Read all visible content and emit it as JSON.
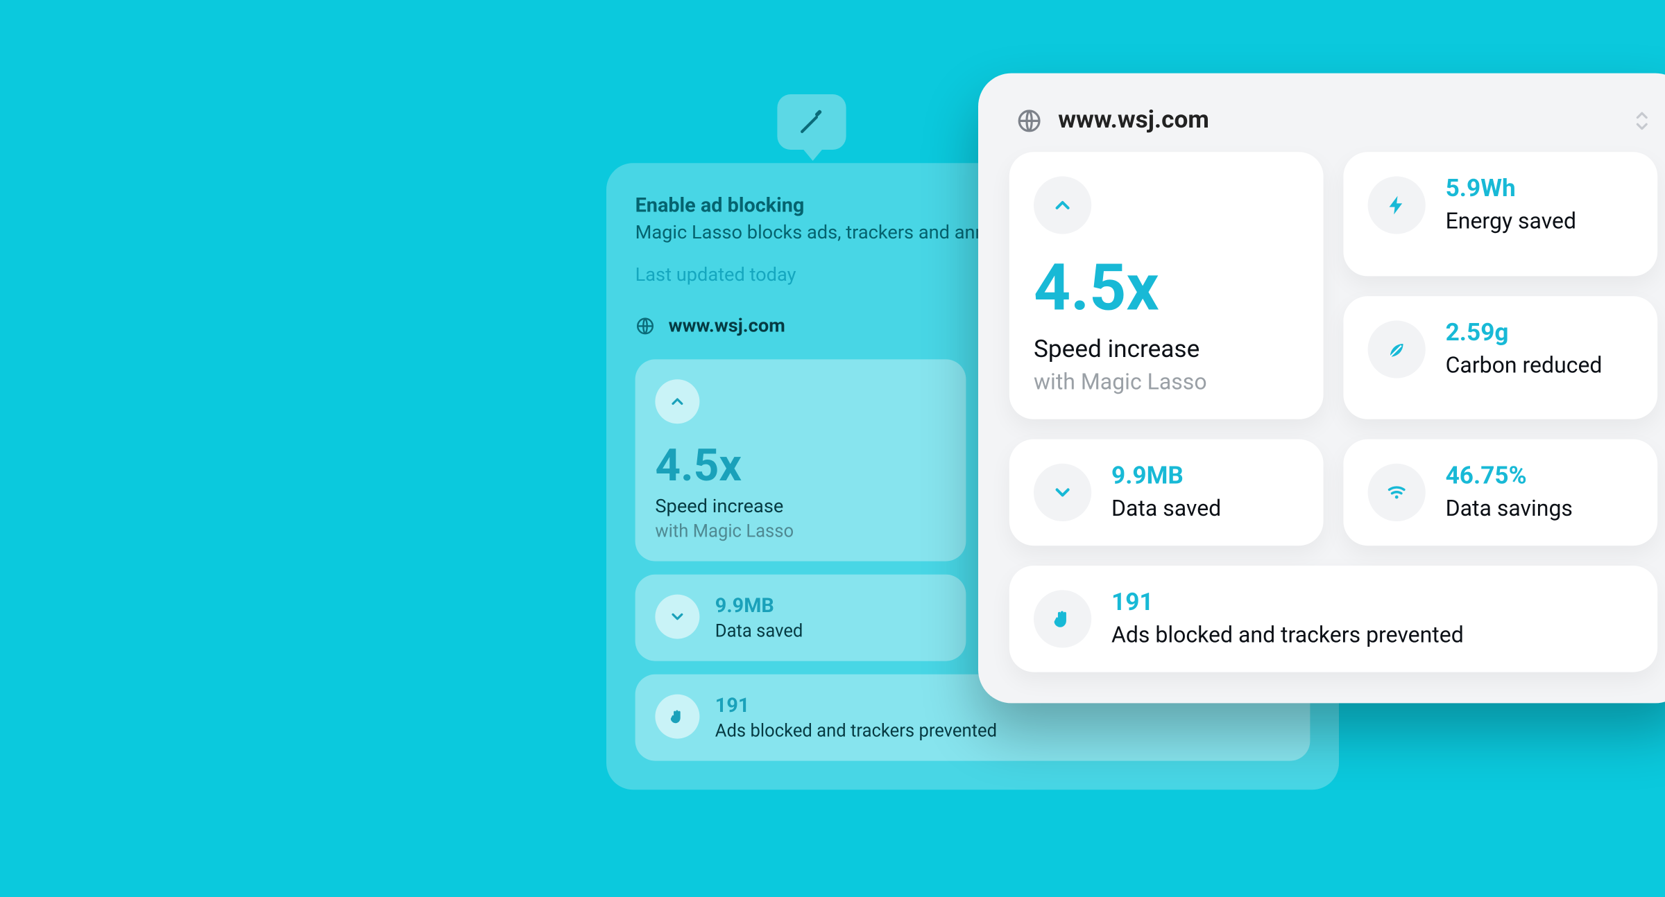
{
  "toolbar": {
    "icon_name": "wand-icon"
  },
  "popover": {
    "title": "Enable ad blocking",
    "subtitle": "Magic Lasso blocks ads, trackers and annoyances",
    "updated": "Last updated today",
    "site": "www.wsj.com"
  },
  "panel": {
    "site": "www.wsj.com"
  },
  "stats": {
    "speed": {
      "value": "4.5x",
      "label": "Speed increase",
      "sublabel": "with Magic Lasso",
      "icon": "chevron-up-icon"
    },
    "energy": {
      "value": "5.9Wh",
      "label": "Energy saved",
      "icon": "bolt-icon"
    },
    "carbon": {
      "value": "2.59g",
      "label": "Carbon reduced",
      "icon": "leaf-icon"
    },
    "data_saved": {
      "value": "9.9MB",
      "label": "Data saved",
      "icon": "chevron-down-icon"
    },
    "data_savings": {
      "value": "46.75%",
      "label": "Data savings",
      "icon": "wifi-icon"
    },
    "blocked": {
      "value": "191",
      "label": "Ads blocked and trackers prevented",
      "icon": "hand-icon"
    }
  },
  "colors": {
    "background": "#0BC9DD",
    "accent": "#18B9D6",
    "panel_bg": "#f3f4f6",
    "card_bg": "#ffffff"
  }
}
